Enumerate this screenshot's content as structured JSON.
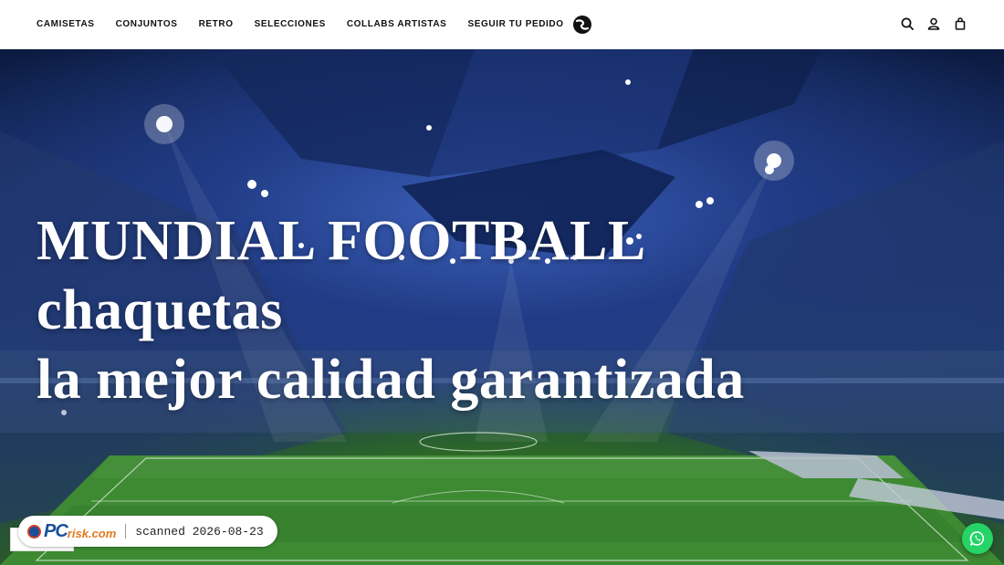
{
  "nav": {
    "items": [
      {
        "label": "CAMISETAS"
      },
      {
        "label": "CONJUNTOS"
      },
      {
        "label": "RETRO"
      },
      {
        "label": "SELECCIONES"
      },
      {
        "label": "COLLABS ARTISTAS"
      },
      {
        "label": "SEGUIR TU PEDIDO"
      }
    ]
  },
  "header_icons": [
    "search-icon",
    "account-icon",
    "cart-icon"
  ],
  "hero": {
    "headline_lines": [
      "MUNDIAL FOOTBALL",
      "chaquetas",
      "la mejor calidad garantizada"
    ]
  },
  "scan_badge": {
    "logo_pc": "PC",
    "logo_risk": "risk.com",
    "text": "scanned 2026-08-23"
  },
  "colors": {
    "whatsapp": "#25d366",
    "nav_text": "#111111",
    "headline": "#ffffff"
  }
}
